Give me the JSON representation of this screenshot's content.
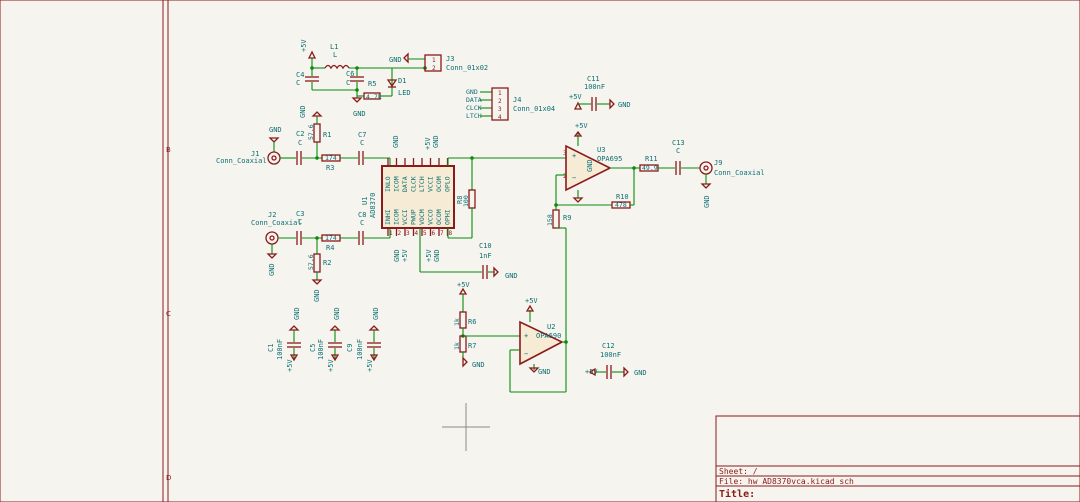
{
  "sheet": {
    "border_letters": [
      "B",
      "C",
      "D"
    ],
    "title_block": {
      "sheet_label": "Sheet: /",
      "file_label": "File: hw_AD8370vca.kicad_sch",
      "title_label": "Title:"
    }
  },
  "power": {
    "gnd": "GND",
    "p5v": "+5V"
  },
  "components": {
    "L1": {
      "ref": "L1",
      "value": "L"
    },
    "C4": {
      "ref": "C4",
      "value": "C"
    },
    "C6": {
      "ref": "C6",
      "value": "C"
    },
    "R5": {
      "ref": "R5",
      "value": "4.7k"
    },
    "D1": {
      "ref": "D1",
      "value": "LED"
    },
    "J3": {
      "ref": "J3",
      "value": "Conn_01x02",
      "pins": [
        "1",
        "2"
      ]
    },
    "J4": {
      "ref": "J4",
      "value": "Conn_01x04",
      "pins": [
        "1",
        "2",
        "3",
        "4"
      ],
      "nets": [
        "GND",
        "DATA",
        "CLCK",
        "LTCH"
      ]
    },
    "C11": {
      "ref": "C11",
      "value": "100nF"
    },
    "J1": {
      "ref": "J1",
      "value": "Conn_Coaxial"
    },
    "J2": {
      "ref": "J2",
      "value": "Conn_Coaxial"
    },
    "J9": {
      "ref": "J9",
      "value": "Conn_Coaxial"
    },
    "C2": {
      "ref": "C2",
      "value": "C"
    },
    "C3": {
      "ref": "C3",
      "value": "C"
    },
    "C7": {
      "ref": "C7",
      "value": "C"
    },
    "C8": {
      "ref": "C8",
      "value": "C"
    },
    "C13": {
      "ref": "C13",
      "value": "C"
    },
    "R1": {
      "ref": "R1",
      "value": "57.6"
    },
    "R2": {
      "ref": "R2",
      "value": "57.6"
    },
    "R3": {
      "ref": "R3",
      "value": "174"
    },
    "R4": {
      "ref": "R4",
      "value": "174"
    },
    "R8": {
      "ref": "R8",
      "value": "100"
    },
    "R11": {
      "ref": "R11",
      "value": "49.9"
    },
    "R10": {
      "ref": "R10",
      "value": "478"
    },
    "R9": {
      "ref": "R9",
      "value": "158"
    },
    "R6": {
      "ref": "R6",
      "value": "1k"
    },
    "R7": {
      "ref": "R7",
      "value": "1k"
    },
    "U1": {
      "ref": "U1",
      "value": "AD8370",
      "top_pins": [
        "INLO",
        "ICOM",
        "DATA",
        "CLCK",
        "LTCH",
        "VCCI",
        "OCOM",
        "OPLO"
      ],
      "bot_pins": [
        "INHI",
        "ICOM",
        "VCCI",
        "PWUP",
        "VOCM",
        "VCCO",
        "OCOM",
        "OPHI"
      ],
      "pin_numbers": [
        "1",
        "2",
        "3",
        "4",
        "5",
        "6",
        "7",
        "8"
      ]
    },
    "U2": {
      "ref": "U2",
      "value": "OPA690",
      "pin_numbers": [
        "2",
        "3",
        "4",
        "5",
        "6",
        "7",
        "8"
      ]
    },
    "U3": {
      "ref": "U3",
      "value": "OPA695",
      "pin_numbers": [
        "2",
        "3",
        "4",
        "5",
        "6",
        "7",
        "8"
      ]
    },
    "C1": {
      "ref": "C1",
      "value": "100nF"
    },
    "C5": {
      "ref": "C5",
      "value": "100nF"
    },
    "C9": {
      "ref": "C9",
      "value": "100nF"
    },
    "C10": {
      "ref": "C10",
      "value": "1nF"
    },
    "C12": {
      "ref": "C12",
      "value": "100nF"
    }
  },
  "labels": {
    "top_gnd": "GND",
    "top_5v": "+5V"
  }
}
